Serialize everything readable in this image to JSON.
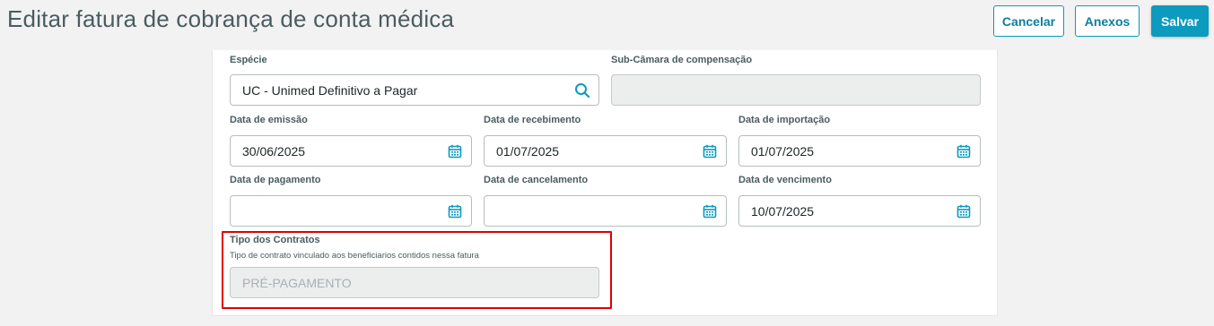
{
  "header": {
    "title": "Editar fatura de cobrança de conta médica",
    "cancel_label": "Cancelar",
    "anexos_label": "Anexos",
    "save_label": "Salvar"
  },
  "form": {
    "especie": {
      "label": "Espécie",
      "value": "UC - Unimed Definitivo a Pagar"
    },
    "subcamara": {
      "label": "Sub-Câmara de compensação",
      "value": ""
    },
    "data_emissao": {
      "label": "Data de emissão",
      "value": "30/06/2025"
    },
    "data_recebimento": {
      "label": "Data de recebimento",
      "value": "01/07/2025"
    },
    "data_importacao": {
      "label": "Data de importação",
      "value": "01/07/2025"
    },
    "data_pagamento": {
      "label": "Data de pagamento",
      "value": ""
    },
    "data_cancelamento": {
      "label": "Data de cancelamento",
      "value": ""
    },
    "data_vencimento": {
      "label": "Data de vencimento",
      "value": "10/07/2025"
    },
    "tipo_contratos": {
      "label": "Tipo dos Contratos",
      "help": "Tipo de contrato vinculado aos beneficiarios contidos nessa fatura",
      "value": "PRÉ-PAGAMENTO"
    }
  },
  "colors": {
    "accent": "#0c9abe",
    "highlight": "#e00000"
  },
  "icons": {
    "search": "search-icon",
    "calendar": "calendar-icon"
  }
}
